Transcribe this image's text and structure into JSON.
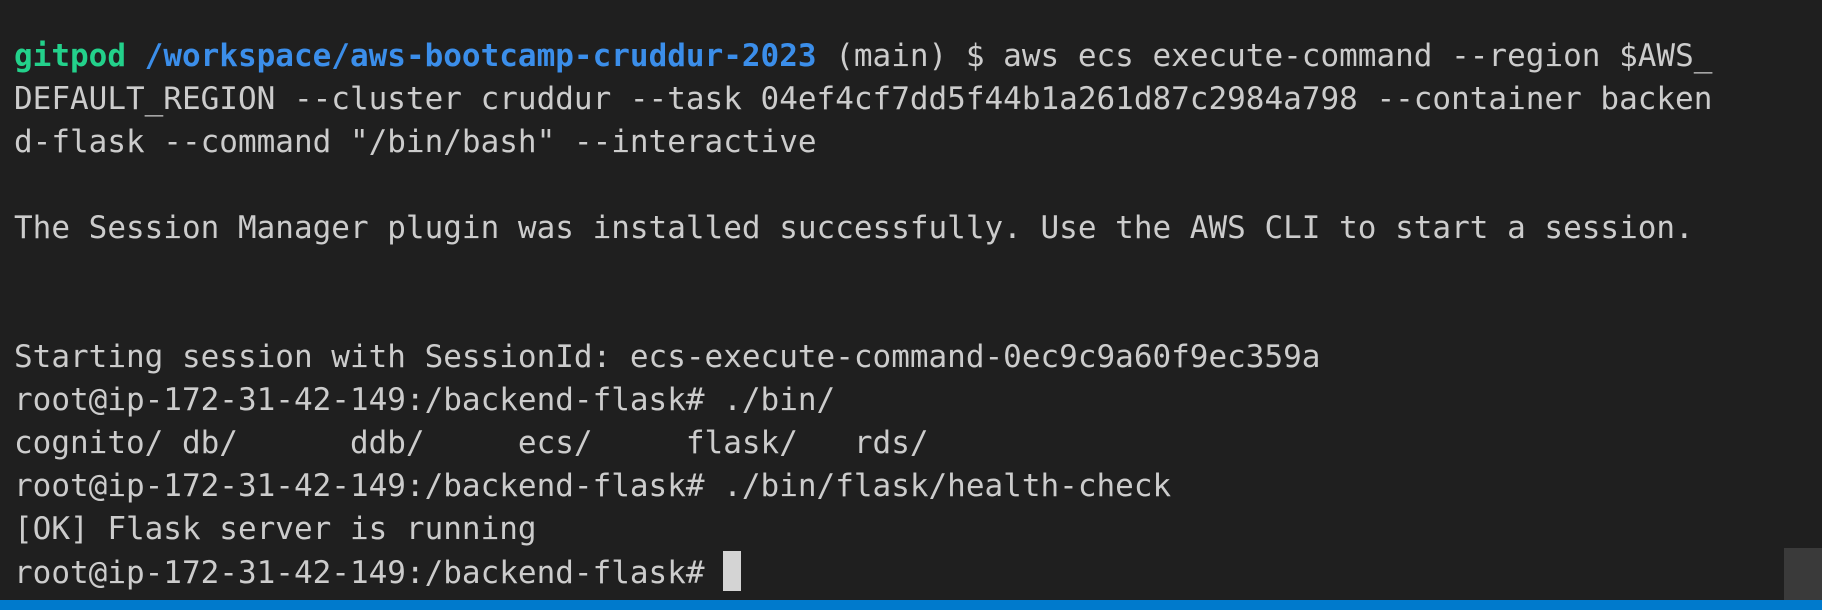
{
  "terminal": {
    "prompt_user": "gitpod",
    "prompt_path": "/workspace/aws-bootcamp-cruddur-2023",
    "line1_rest": " (main) $ aws ecs execute-command --region $AWS_",
    "line2": "DEFAULT_REGION --cluster cruddur --task 04ef4cf7dd5f44b1a261d87c2984a798 --container backen",
    "line3": "d-flask --command \"/bin/bash\" --interactive",
    "line4": "",
    "line5": "The Session Manager plugin was installed successfully. Use the AWS CLI to start a session.",
    "line6": "",
    "line7": "",
    "line8": "Starting session with SessionId: ecs-execute-command-0ec9c9a60f9ec359a",
    "line9": "root@ip-172-31-42-149:/backend-flask# ./bin/",
    "line10": "cognito/ db/      ddb/     ecs/     flask/   rds/",
    "line11": "root@ip-172-31-42-149:/backend-flask# ./bin/flask/health-check",
    "line12": "[OK] Flask server is running",
    "line13": "root@ip-172-31-42-149:/backend-flask# "
  },
  "colors": {
    "background": "#1f1f1f",
    "text": "#cccccc",
    "prompt_user": "#23d18b",
    "prompt_path": "#3b8eea",
    "status_bar": "#007acc"
  }
}
